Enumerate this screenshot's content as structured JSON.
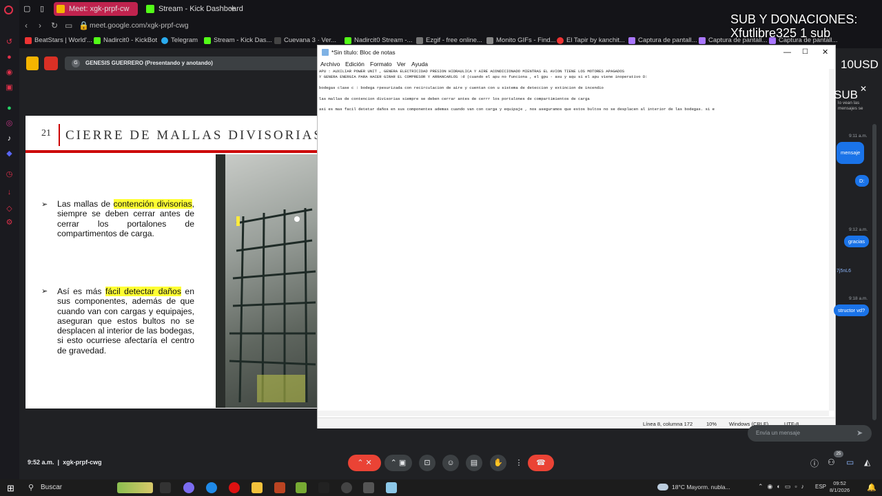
{
  "browser": {
    "tabs": [
      {
        "label": "Meet: xgk-prpf-cw",
        "favicon_color": "#c0234e"
      },
      {
        "label": "Stream - Kick Dashboard",
        "favicon_color": "#53fc18"
      }
    ],
    "url": "meet.google.com/xgk-prpf-cwg",
    "bookmarks": [
      "BeatStars | World'...",
      "Nadircit0 - KickBot",
      "Telegram",
      "Stream - Kick Das...",
      "Cuevana 3 · Ver...",
      "Nadircit0 Stream -...",
      "Ezgif - free online...",
      "Monito GIFs - Find...",
      "El Tapir by kanchit...",
      "Captura de pantall...",
      "Captura de pantall...",
      "Captura de pantall..."
    ]
  },
  "overlay": {
    "line1": "SUB Y DONACIONES:",
    "line2": "Xfutlibre325 1 sub",
    "amount": "10USD",
    "sub": "SUB"
  },
  "meet": {
    "presenter": "GENESIS GUERRERO (Presentando y anotando)",
    "presenter_initial": "G",
    "time": "9:52 a.m.",
    "separator": "|",
    "code": "xgk-prpf-cwg",
    "participants_count": "25",
    "chat_placeholder": "Envía un mensaje"
  },
  "slide": {
    "number": "21",
    "title": "CIERRE DE MALLAS DIVISORIAS",
    "bullet1_pre": "Las mallas de ",
    "bullet1_hl": "contención divisorias",
    "bullet1_post": ", siempre se deben cerrar antes de cerrar los portalones de compartimentos de carga.",
    "bullet2_pre": "Así es más ",
    "bullet2_hl": "fácil detectar daños",
    "bullet2_post": " en sus componentes, además de que cuando van con cargas y equipajes, aseguran que estos bultos no se desplacen al interior de las bodegas, si esto ocurriese afectaría el centro de gravedad."
  },
  "notepad": {
    "title": "*Sin título: Bloc de notas",
    "menu": [
      "Archivo",
      "Edición",
      "Formato",
      "Ver",
      "Ayuda"
    ],
    "text": "APU : AUXILIAR POWER UNIT , GENERA ELECTRICIDAD PRESION HIDRAULICA Y AIRE ACONDICIONADO MIENTRAS EL AVION TIENE LOS MOTORES APAGADOS\nY GENERA ENERGIA PARA HACER GIRAR EL COMPRESOR Y ARRANCARLOS :d (cuando el apu no funciona , el gpu - asu y aqu si el apu viene inoperativo D:\n\nbodegas clase c : bodega rpesurizada con recirculacion de aire y cuentan con u sistema de deteccion y extincion de incendio\n\nlas mallas de contencion divisorias siempre se deben cerrar antes de cerrr los portalones de compartimientos de carga\n\nasi es mas facil detetar daños en sus componentes ademas cuando van con carga y equipaje , nos aseguramos que estos bultos no se desplacen al interior de las bodegas. si e",
    "status_pos": "Línea 8, columna 172",
    "status_zoom": "10%",
    "status_eol": "Windows (CRLF)",
    "status_enc": "UTF-8"
  },
  "chat": {
    "times": [
      "9:11 a.m.",
      "9:12 a.m.",
      "9:18 a.m."
    ],
    "messages": [
      "mensaje",
      "D:",
      "gracias",
      "7j5nL6",
      "structor vd?"
    ],
    "snippet": "lo vean las\nmensajes se"
  },
  "taskbar": {
    "search": "Buscar",
    "weather": "18°C  Mayorm. nubla...",
    "lang": "ESP",
    "time": "09:52",
    "date": "8/1/2026"
  }
}
